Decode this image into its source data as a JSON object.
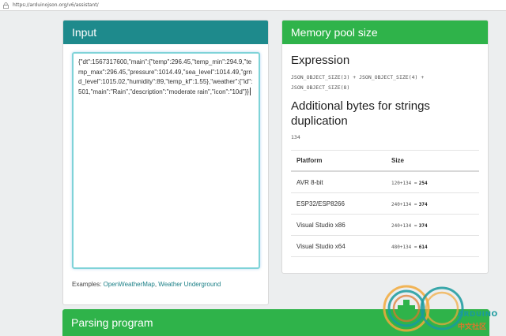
{
  "browser": {
    "url": "https://arduinojson.org/v6/assistant/"
  },
  "input": {
    "title": "Input",
    "json_text": "{\"dt\":1567317600,\"main\":{\"temp\":296.45,\"temp_min\":294.9,\"temp_max\":296.45,\"pressure\":1014.49,\"sea_level\":1014.49,\"grnd_level\":1015.02,\"humidity\":89,\"temp_kf\":1.55},\"weather\":{\"id\":501,\"main\":\"Rain\",\"description\":\"moderate rain\",\"icon\":\"10d\"}}",
    "examples_label": "Examples:",
    "example_links": [
      "OpenWeatherMap",
      "Weather Underground"
    ],
    "examples_separator": ","
  },
  "memory": {
    "title": "Memory pool size",
    "expression_heading": "Expression",
    "expression_code": "JSON_OBJECT_SIZE(3) + JSON_OBJECT_SIZE(4) + JSON_OBJECT_SIZE(8)",
    "additional_heading": "Additional bytes for strings duplication",
    "additional_value": "134",
    "table": {
      "headers": [
        "Platform",
        "Size"
      ],
      "rows": [
        {
          "platform": "AVR 8-bit",
          "expr": "120+134 =",
          "total": "254"
        },
        {
          "platform": "ESP32/ESP8266",
          "expr": "240+134 =",
          "total": "374"
        },
        {
          "platform": "Visual Studio x86",
          "expr": "240+134 =",
          "total": "374"
        },
        {
          "platform": "Visual Studio x64",
          "expr": "480+134 =",
          "total": "614"
        }
      ]
    }
  },
  "parsing": {
    "title": "Parsing program"
  },
  "watermark": {
    "name": "ARDUINO",
    "sub": "中文社区"
  },
  "colors": {
    "input_header": "#1e8a8c",
    "memory_header": "#2fb34a",
    "link": "#1a7f86"
  }
}
